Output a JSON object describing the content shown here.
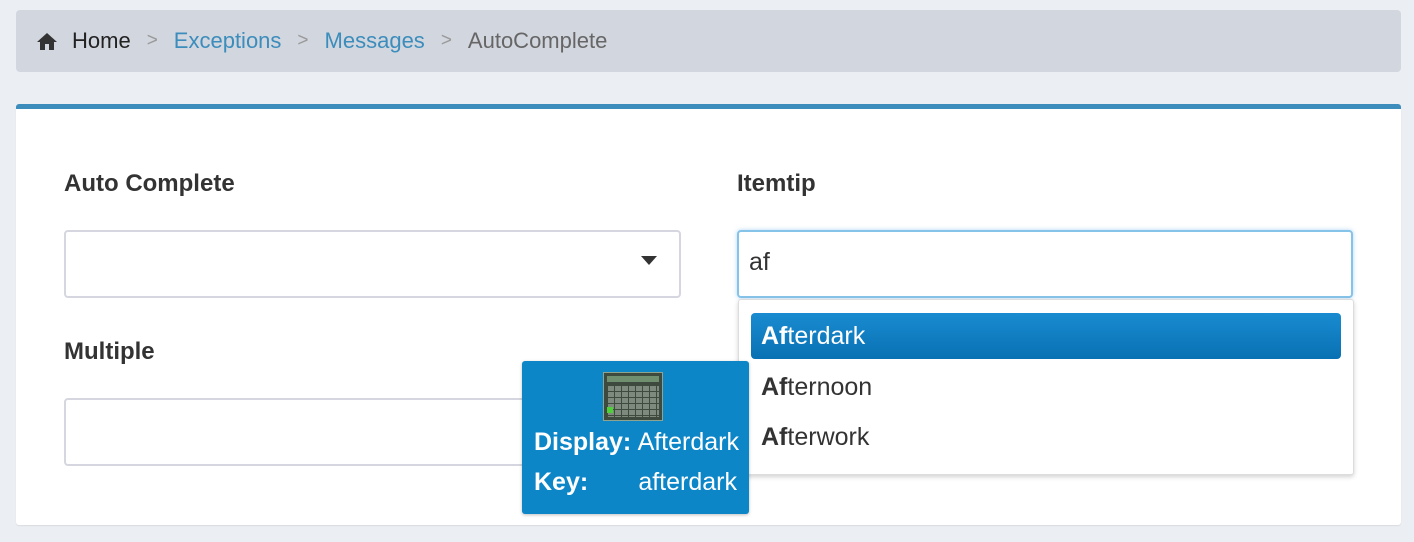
{
  "breadcrumb": {
    "home": "Home",
    "separator": ">",
    "items": [
      "Exceptions",
      "Messages"
    ],
    "current": "AutoComplete"
  },
  "autocomplete": {
    "label": "Auto Complete",
    "value": ""
  },
  "multiple": {
    "label": "Multiple",
    "value": ""
  },
  "itemtip": {
    "label": "Itemtip",
    "value": "af",
    "suggestions": [
      {
        "match": "Af",
        "rest": "terdark",
        "active": true
      },
      {
        "match": "Af",
        "rest": "ternoon",
        "active": false
      },
      {
        "match": "Af",
        "rest": "terwork",
        "active": false
      }
    ]
  },
  "tooltip": {
    "display_key": "Display:",
    "display_value": "Afterdark",
    "key_key": "Key:",
    "key_value": "afterdark",
    "thumbnail_icon": "theme-thumbnail-icon"
  },
  "colors": {
    "accent": "#3c8dbc",
    "tooltip_bg": "#0d86c8",
    "active_item": "#0871b3"
  }
}
